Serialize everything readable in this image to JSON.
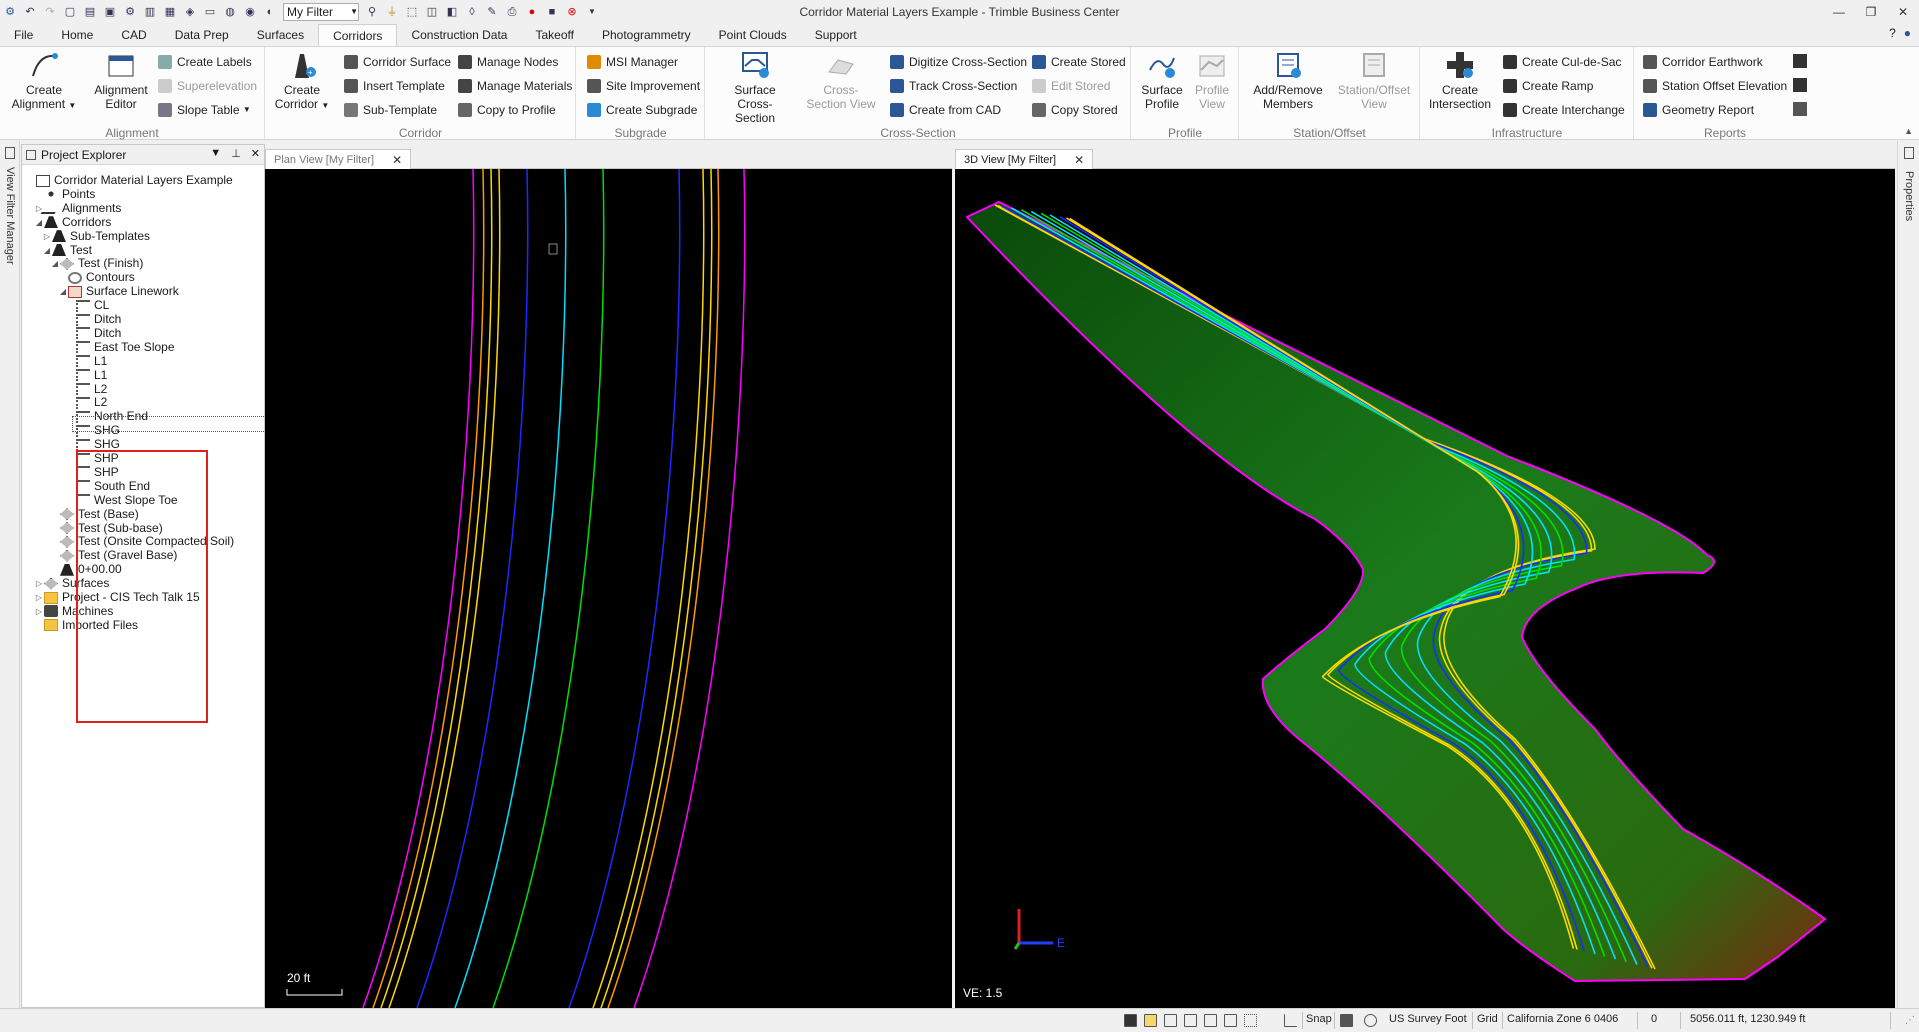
{
  "window": {
    "title": "Corridor Material Layers Example - Trimble Business Center",
    "filter_value": "My Filter"
  },
  "menu": {
    "tabs": [
      "File",
      "Home",
      "CAD",
      "Data Prep",
      "Surfaces",
      "Corridors",
      "Construction Data",
      "Takeoff",
      "Photogrammetry",
      "Point Clouds",
      "Support"
    ],
    "active": "Corridors"
  },
  "ribbon": {
    "alignment": {
      "label": "Alignment",
      "create_alignment": "Create Alignment",
      "alignment_editor": "Alignment Editor",
      "create_labels": "Create Labels",
      "superelevation": "Superelevation",
      "slope_table": "Slope Table"
    },
    "corridor": {
      "label": "Corridor",
      "create_corridor": "Create Corridor",
      "corridor_surface": "Corridor Surface",
      "insert_template": "Insert Template",
      "sub_template": "Sub-Template",
      "manage_nodes": "Manage Nodes",
      "manage_materials": "Manage Materials",
      "copy_to_profile": "Copy to Profile"
    },
    "subgrade": {
      "label": "Subgrade",
      "msi_manager": "MSI Manager",
      "site_improvement": "Site Improvement",
      "create_subgrade": "Create Subgrade"
    },
    "cross_section": {
      "label": "Cross-Section",
      "surface_cross_section": "Surface Cross-Section",
      "cross_section_view": "Cross-Section View",
      "digitize_cross_section": "Digitize Cross-Section",
      "track_cross_section": "Track Cross-Section",
      "create_from_cad": "Create from CAD",
      "create_stored": "Create Stored",
      "edit_stored": "Edit Stored",
      "copy_stored": "Copy Stored"
    },
    "profile": {
      "label": "Profile",
      "surface_profile": "Surface Profile",
      "profile_view": "Profile View"
    },
    "station_offset": {
      "label": "Station/Offset",
      "add_remove_members": "Add/Remove Members",
      "station_offset_view": "Station/Offset View"
    },
    "infrastructure": {
      "label": "Infrastructure",
      "create_intersection": "Create Intersection",
      "create_cul_de_sac": "Create Cul-de-Sac",
      "create_ramp": "Create Ramp",
      "create_interchange": "Create Interchange"
    },
    "reports": {
      "label": "Reports",
      "corridor_earthwork": "Corridor Earthwork",
      "station_offset_elevation": "Station Offset Elevation",
      "geometry_report": "Geometry Report"
    }
  },
  "side_tabs": {
    "left": "View Filter Manager",
    "right": "Properties"
  },
  "explorer": {
    "title": "Project Explorer",
    "tree": [
      {
        "label": "Corridor Material Layers Example",
        "indent": 0,
        "arrow": "",
        "icon": "project-icon"
      },
      {
        "label": "Points",
        "indent": 1,
        "arrow": "",
        "icon": "points-icon"
      },
      {
        "label": "Alignments",
        "indent": 1,
        "arrow": "▷",
        "icon": "alignment-icon"
      },
      {
        "label": "Corridors",
        "indent": 1,
        "arrow": "◢",
        "icon": "corridor-icon"
      },
      {
        "label": "Sub-Templates",
        "indent": 2,
        "arrow": "▷",
        "icon": "corridor-icon"
      },
      {
        "label": "Test",
        "indent": 2,
        "arrow": "◢",
        "icon": "corridor-icon"
      },
      {
        "label": "Test (Finish)",
        "indent": 3,
        "arrow": "◢",
        "icon": "surface-icon"
      },
      {
        "label": "Contours",
        "indent": 4,
        "arrow": "",
        "icon": "contours-icon"
      },
      {
        "label": "Surface Linework",
        "indent": 4,
        "arrow": "◢",
        "icon": "linework-icon"
      },
      {
        "label": "CL",
        "indent": 5,
        "arrow": "",
        "icon": "line-icon"
      },
      {
        "label": "Ditch",
        "indent": 5,
        "arrow": "",
        "icon": "line-icon"
      },
      {
        "label": "Ditch",
        "indent": 5,
        "arrow": "",
        "icon": "line-icon"
      },
      {
        "label": "East Toe Slope",
        "indent": 5,
        "arrow": "",
        "icon": "line-icon"
      },
      {
        "label": "L1",
        "indent": 5,
        "arrow": "",
        "icon": "line-icon"
      },
      {
        "label": "L1",
        "indent": 5,
        "arrow": "",
        "icon": "line-icon"
      },
      {
        "label": "L2",
        "indent": 5,
        "arrow": "",
        "icon": "line-icon"
      },
      {
        "label": "L2",
        "indent": 5,
        "arrow": "",
        "icon": "line-icon"
      },
      {
        "label": "North End",
        "indent": 5,
        "arrow": "",
        "icon": "line-icon"
      },
      {
        "label": "SHG",
        "indent": 5,
        "arrow": "",
        "icon": "line-icon"
      },
      {
        "label": "SHG",
        "indent": 5,
        "arrow": "",
        "icon": "line-icon"
      },
      {
        "label": "SHP",
        "indent": 5,
        "arrow": "",
        "icon": "line-icon"
      },
      {
        "label": "SHP",
        "indent": 5,
        "arrow": "",
        "icon": "line-icon"
      },
      {
        "label": "South End",
        "indent": 5,
        "arrow": "",
        "icon": "line-icon"
      },
      {
        "label": "West Slope Toe",
        "indent": 5,
        "arrow": "",
        "icon": "line-icon"
      },
      {
        "label": "Test (Base)",
        "indent": 3,
        "arrow": "",
        "icon": "surface-icon"
      },
      {
        "label": "Test (Sub-base)",
        "indent": 3,
        "arrow": "",
        "icon": "surface-icon"
      },
      {
        "label": "Test (Onsite Compacted Soil)",
        "indent": 3,
        "arrow": "",
        "icon": "surface-icon"
      },
      {
        "label": "Test (Gravel Base)",
        "indent": 3,
        "arrow": "",
        "icon": "surface-icon"
      },
      {
        "label": "0+00.00",
        "indent": 3,
        "arrow": "",
        "icon": "corridor-icon"
      },
      {
        "label": "Surfaces",
        "indent": 1,
        "arrow": "▷",
        "icon": "surface-icon"
      },
      {
        "label": "Project - CIS Tech Talk 15",
        "indent": 1,
        "arrow": "▷",
        "icon": "folder-icon"
      },
      {
        "label": "Machines",
        "indent": 1,
        "arrow": "▷",
        "icon": "machine-icon"
      },
      {
        "label": "Imported Files",
        "indent": 1,
        "arrow": "",
        "icon": "folder-icon"
      }
    ]
  },
  "plan_view": {
    "tab_label": "Plan View [My Filter]",
    "scale_label": "20 ft"
  },
  "view_3d": {
    "tab_label": "3D View [My Filter]",
    "ve_label": "VE: 1.5",
    "axis_label": "E"
  },
  "status": {
    "snap": "Snap",
    "units": "US Survey Foot",
    "grid": "Grid",
    "zone": "California Zone 6 0406",
    "count": "0",
    "coords": "5056.011 ft, 1230.949 ft"
  },
  "colors": {
    "accent": "#2b5797",
    "magenta": "#ff00ff",
    "yellow": "#ffd800",
    "orange": "#ff9a00",
    "blue": "#1a2bff",
    "green": "#00e000",
    "cyan": "#00e0ff"
  }
}
